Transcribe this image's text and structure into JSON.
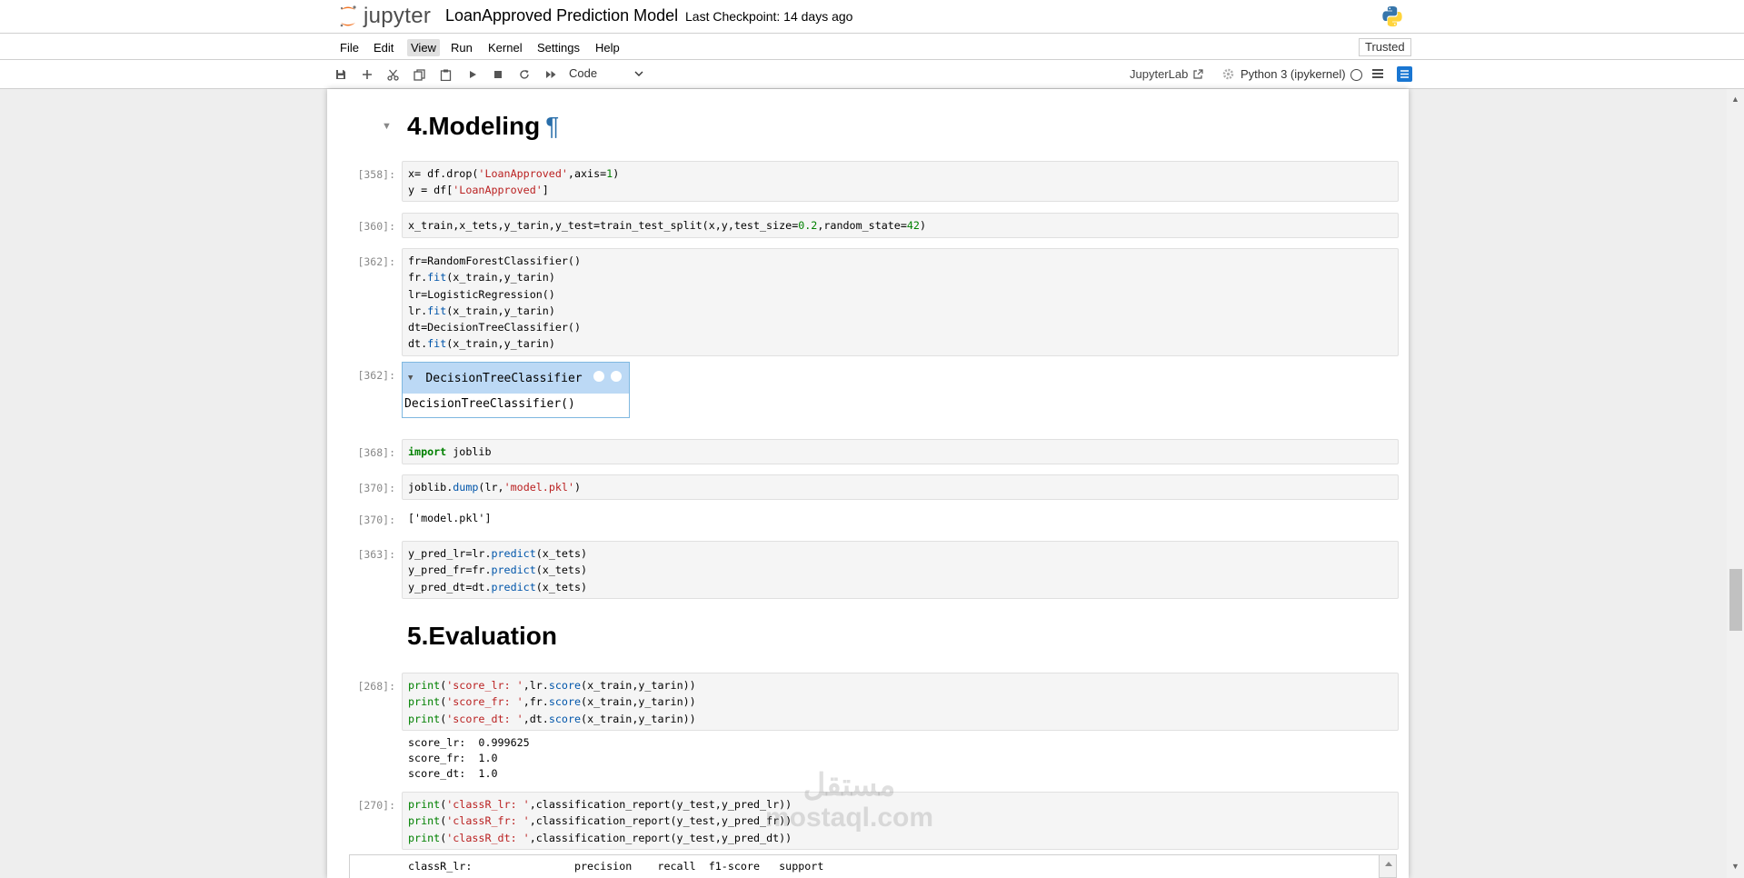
{
  "header": {
    "logo_text": "jupyter",
    "notebook_title": "LoanApproved Prediction Model",
    "checkpoint": "Last Checkpoint: 14 days ago"
  },
  "menubar": {
    "items": [
      "File",
      "Edit",
      "View",
      "Run",
      "Kernel",
      "Settings",
      "Help"
    ],
    "active": "View",
    "trusted": "Trusted"
  },
  "toolbar": {
    "cell_type": "Code",
    "jupyterlab_label": "JupyterLab",
    "kernel_name": "Python 3 (ipykernel)",
    "icons": [
      "save-icon",
      "add-cell-icon",
      "cut-icon",
      "copy-icon",
      "paste-icon",
      "run-icon",
      "stop-icon",
      "restart-icon",
      "fast-forward-icon"
    ]
  },
  "notebook": {
    "heading_modeling": "4.Modeling",
    "heading_anchor": "¶",
    "heading_evaluation": "5.Evaluation",
    "cells": [
      {
        "prompt": "[358]:"
      },
      {
        "prompt": "[360]:"
      },
      {
        "prompt": "[362]:"
      },
      {
        "prompt": "[362]:"
      },
      {
        "prompt": "[368]:"
      },
      {
        "prompt": "[370]:"
      },
      {
        "prompt": "[370]:"
      },
      {
        "prompt": "[363]:"
      },
      {
        "prompt": "[268]:"
      },
      {
        "prompt": "[270]:"
      }
    ],
    "widget": {
      "title": "DecisionTreeClassifier",
      "body": "DecisionTreeClassifier()"
    },
    "outputs": {
      "model_file": "['model.pkl']",
      "scores": [
        "score_lr:  0.999625",
        "score_fr:  1.0",
        "score_dt:  1.0"
      ],
      "report_header": "classR_lr:                precision    recall  f1-score   support"
    }
  },
  "watermark": {
    "line1": "مستقل",
    "line2": "mostaql.com"
  }
}
